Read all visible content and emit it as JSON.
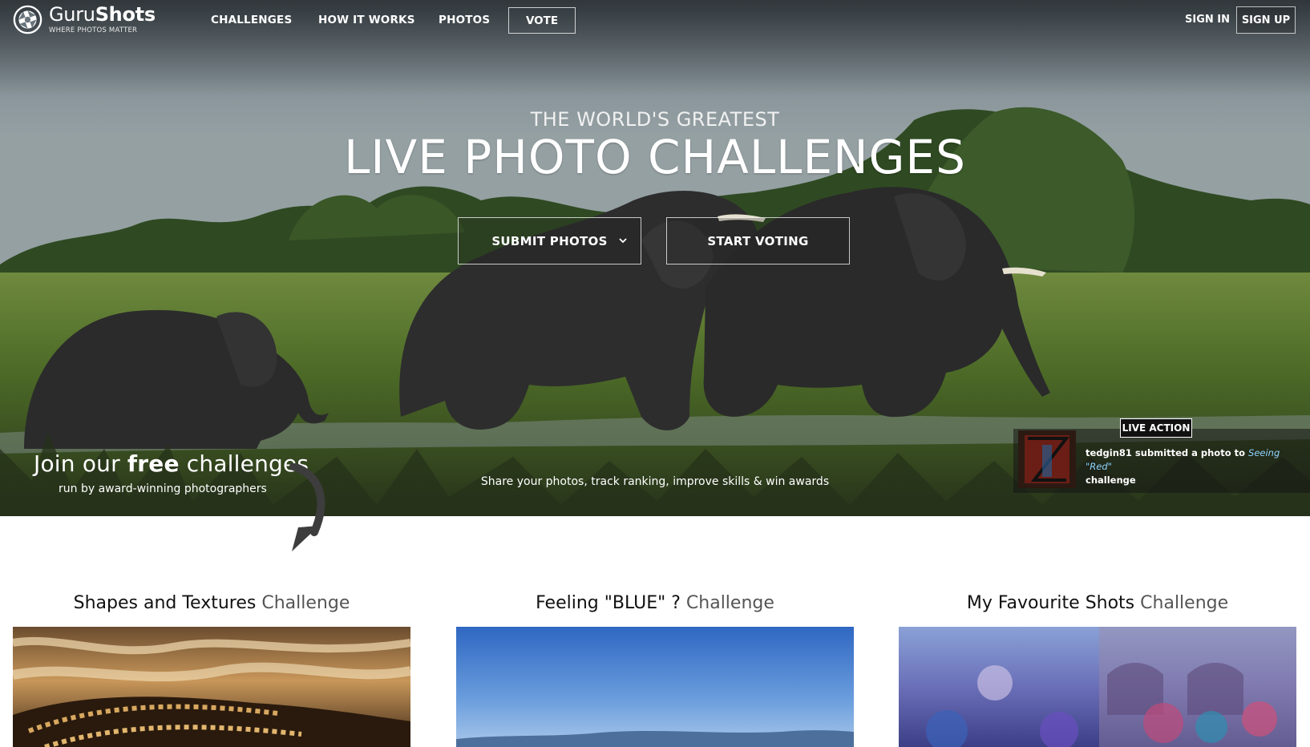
{
  "header": {
    "logo": {
      "name_part1": "Guru",
      "name_part2": "Shots",
      "tagline": "WHERE PHOTOS MATTER"
    },
    "nav": [
      {
        "label": "CHALLENGES"
      },
      {
        "label": "HOW IT WORKS"
      },
      {
        "label": "PHOTOS"
      },
      {
        "label": "VOTE"
      }
    ],
    "auth": {
      "sign_in": "SIGN IN",
      "sign_up": "SIGN UP"
    }
  },
  "hero": {
    "kicker": "THE WORLD'S GREATEST",
    "headline": "LIVE PHOTO CHALLENGES",
    "buttons": {
      "submit": "SUBMIT PHOTOS",
      "vote": "START VOTING"
    },
    "join": {
      "prefix": "Join our ",
      "bold": "free",
      "suffix": " challenges",
      "sub": "run by award-winning photographers"
    },
    "share_line": "Share your photos, track ranking, improve skills & win awards",
    "live": {
      "badge": "LIVE ACTION",
      "user": "tedgin81",
      "action": " submitted a photo to ",
      "challenge": "Seeing \"Red\"",
      "tail": "challenge"
    }
  },
  "challenges": [
    {
      "name": "Shapes and Textures",
      "suffix": "Challenge"
    },
    {
      "name": "Feeling \"BLUE\" ?",
      "suffix": "Challenge"
    },
    {
      "name": "My Favourite Shots",
      "suffix": "Challenge"
    }
  ],
  "icons": {
    "logo": "camera-aperture-icon",
    "dropdown": "chevron-down-icon",
    "arrow": "curved-arrow-down-icon"
  },
  "colors": {
    "link": "#8fd3ff",
    "badge_bg": "#111111"
  }
}
